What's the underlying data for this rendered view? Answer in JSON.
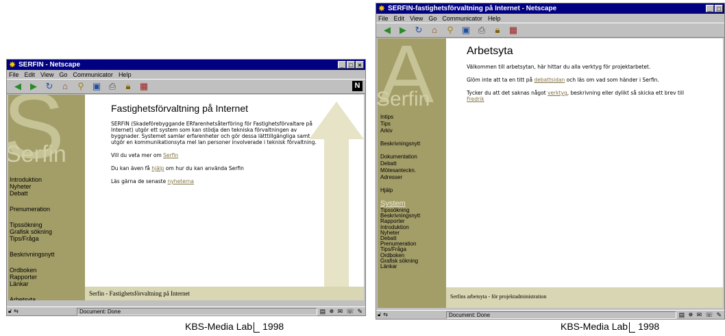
{
  "menu": [
    "File",
    "Edit",
    "View",
    "Go",
    "Communicator",
    "Help"
  ],
  "w1": {
    "title": "SERFIN - Netscape",
    "logo_letter": "S",
    "wordmark": "Serfin",
    "nav_groups": [
      [
        "Introduktion",
        "Nyheter",
        "Debatt"
      ],
      [
        "Prenumeration"
      ],
      [
        "Tipssökning",
        "Grafisk sökning",
        "Tips/Fråga"
      ],
      [
        "Beskrivningsnytt"
      ],
      [
        "Ordboken",
        "Rapporter",
        "Länkar"
      ],
      [
        "Arbetsyta"
      ]
    ],
    "heading": "Fastighetsförvaltning på Internet",
    "intro": "SERFIN (Skadeförebyggande ERfarenhetsåterföring för Fastighetsförvaltare på Internet) utgör ett system som kan stödja den tekniska förvaltningen av byggnader. Systemet samlar erfarenheter och gör dessa lätttillgängliga samt utgör en kommunikationsyta mel lan personer involverade i teknisk förvaltning.",
    "p2_pre": "Vill du veta mer om ",
    "p2_link": "Serfin",
    "p3_pre": "Du kan även få ",
    "p3_link": "hjälp",
    "p3_post": " om hur du kan använda Serfin",
    "p4_pre": "Läs gärna de senaste ",
    "p4_link": "nyheterna",
    "footer": "Serfin - Fastighetsförvaltning på Internet",
    "status": "Document: Done"
  },
  "w2": {
    "title": "SERFIN-fastighetsförvaltning på Internet - Netscape",
    "logo_letter": "A",
    "wordmark": "Serfin",
    "nav_groups": [
      [
        "Intips",
        "Tips",
        "Arkiv"
      ],
      [
        "Beskrivningsnytt"
      ],
      [
        "Dokumentation",
        "Debatt",
        "Mötesanteckn.",
        "Adresser"
      ],
      [
        "Hjälp"
      ]
    ],
    "system_label": "System",
    "system_items": [
      "Tipssökning",
      "Beskrivningsnytt",
      "Rapporter",
      "Introduktion",
      "Nyheter",
      "Debatt",
      "Prenumeration",
      "Tips/Fråga",
      "Ordboken",
      "Grafisk sökning",
      "Länkar"
    ],
    "heading": "Arbetsyta",
    "p1": "Välkommen till arbetsytan, här hittar du alla verktyg för projektarbetet.",
    "p2_pre": "Glöm inte att ta en titt på ",
    "p2_link": "debattsidan",
    "p2_post": " och läs om vad som händer i Serfin.",
    "p3_pre": "Tycker du att det saknas något ",
    "p3_link": "verktyg",
    "p3_mid": ", beskrivning eller dylikt så skicka ett brev till ",
    "p3_link2": "Fredrik",
    "footer": "Serfins arbetsyta - för projektadministration",
    "status": "Document: Done"
  },
  "caption_left": {
    "text": "KBS-Media Lab",
    "year": "1998"
  },
  "caption_right": {
    "text": "KBS-Media Lab",
    "year": "1998"
  },
  "colors": {
    "sidebar": "#a39d68",
    "footer": "#d9d6b3",
    "titlebar": "#000080",
    "link": "#807040"
  }
}
